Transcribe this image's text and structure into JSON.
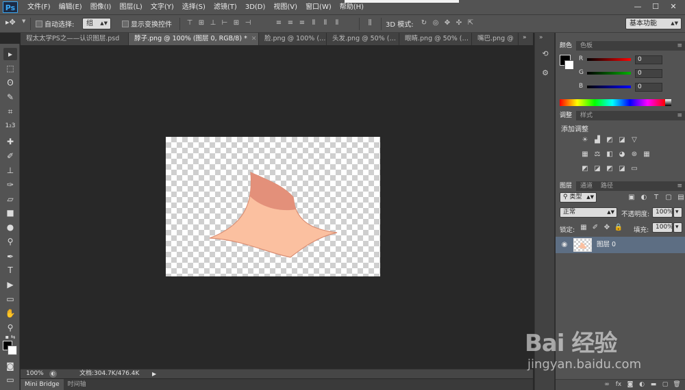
{
  "app": {
    "logo_text": "Ps"
  },
  "menu": [
    "文件(F)",
    "编辑(E)",
    "图像(I)",
    "图层(L)",
    "文字(Y)",
    "选择(S)",
    "滤镜(T)",
    "3D(D)",
    "视图(V)",
    "窗口(W)",
    "帮助(H)"
  ],
  "window_controls": {
    "minimize": "—",
    "maximize": "☐",
    "close": "✕"
  },
  "options": {
    "auto_select_label": "自动选择:",
    "auto_select_value": "组",
    "show_transform_label": "显示变换控件",
    "mode_3d_label": "3D 模式:",
    "workspace": "基本功能"
  },
  "doc_tabs": [
    {
      "label": "程太太学PS之——认识图层.psd",
      "active": false
    },
    {
      "label": "脖子.png @ 100% (图层 0, RGB/8) *",
      "active": true
    },
    {
      "label": "脸.png @ 100% (…",
      "active": false
    },
    {
      "label": "头发.png @ 50% (…",
      "active": false
    },
    {
      "label": "眼睛.png @ 50% (…",
      "active": false
    },
    {
      "label": "嘴巴.png @",
      "active": false
    }
  ],
  "tab_overflow": "»",
  "status": {
    "zoom": "100%",
    "doc_size": "文档:304.7K/476.4K",
    "arrow": "▶"
  },
  "bottom_tabs": [
    {
      "label": "Mini Bridge",
      "active": true
    },
    {
      "label": "时间轴",
      "active": false
    }
  ],
  "color_panel": {
    "tabs": [
      {
        "label": "颜色",
        "active": true
      },
      {
        "label": "色板",
        "active": false
      }
    ],
    "sliders": [
      {
        "label": "R",
        "value": "0",
        "color": "#ff0000"
      },
      {
        "label": "G",
        "value": "0",
        "color": "#00b000"
      },
      {
        "label": "B",
        "value": "0",
        "color": "#0000ff"
      }
    ]
  },
  "adjust_panel": {
    "tabs": [
      {
        "label": "调整",
        "active": true
      },
      {
        "label": "样式",
        "active": false
      }
    ],
    "title": "添加调整"
  },
  "layers_panel": {
    "tabs": [
      {
        "label": "图层",
        "active": true
      },
      {
        "label": "通道",
        "active": false
      },
      {
        "label": "路径",
        "active": false
      }
    ],
    "kind": "类型",
    "blend_mode": "正常",
    "opacity_label": "不透明度:",
    "opacity_value": "100%",
    "lock_label": "锁定:",
    "fill_label": "填充:",
    "fill_value": "100%",
    "layer_name": "图层 0"
  },
  "colors": {
    "neck_light": "#fbc0a0",
    "neck_shadow": "#e3907a",
    "neck_outline": "#d98e74",
    "selected_layer": "#5d6e83"
  },
  "watermark": {
    "logo": "Bai 经验",
    "url": "jingyan.baidu.com"
  }
}
